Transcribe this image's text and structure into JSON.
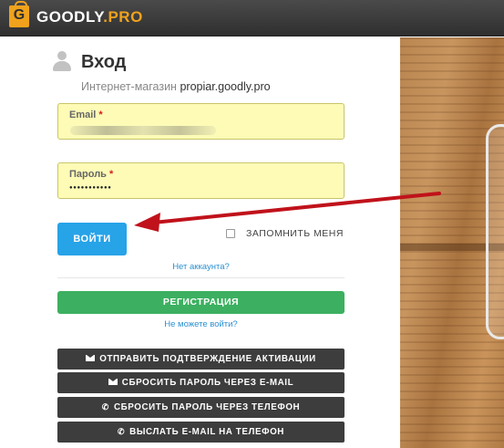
{
  "header": {
    "logo_letter": "G",
    "logo_main": "GOODLY",
    "logo_suffix": ".PRO"
  },
  "login": {
    "title": "Вход",
    "subtitle_prefix": "Интернет-магазин",
    "store_name": "propiar.goodly.pro",
    "email_label": "Email",
    "password_label": "Пароль",
    "required_mark": "*",
    "password_value": "●●●●●●●●●●●",
    "login_button": "ВОЙТИ",
    "remember_me": "ЗАПОМНИТЬ МЕНЯ",
    "no_account_link": "Нет аккаунта?",
    "register_button": "РЕГИСТРАЦИЯ",
    "cant_login_link": "Не можете войти?"
  },
  "actions": [
    {
      "icon": "envelope-icon",
      "label": "ОТПРАВИТЬ ПОДТВЕРЖДЕНИЕ АКТИВАЦИИ"
    },
    {
      "icon": "envelope-icon",
      "label": "СБРОСИТЬ ПАРОЛЬ ЧЕРЕЗ E-MAIL"
    },
    {
      "icon": "phone-icon",
      "label": "СБРОСИТЬ ПАРОЛЬ ЧЕРЕЗ ТЕЛЕФОН"
    },
    {
      "icon": "phone-icon",
      "label": "ВЫСЛАТЬ E-MAIL НА ТЕЛЕФОН"
    }
  ],
  "colors": {
    "accent_orange": "#f0a21c",
    "login_blue": "#27a3e8",
    "register_green": "#3cb060",
    "field_yellow": "#fdfbb6",
    "arrow_red": "#c0121b"
  }
}
